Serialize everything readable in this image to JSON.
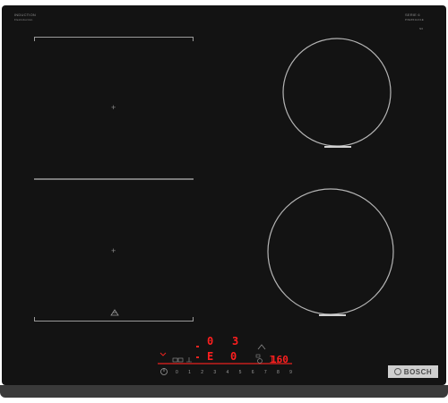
{
  "branding": {
    "top_left_label": "INDUCTION",
    "top_left_sublabel": "FlexInduction",
    "top_right_label": "SERIE 6",
    "top_right_sublabel": "PXE651HC1E",
    "top_right_code": "N6",
    "logo_text": "BOSCH"
  },
  "display": {
    "upper_value": "0",
    "upper_right_value": "3",
    "lower_value": "0",
    "lower_left_glyph": "E",
    "temperature": "160",
    "timer_glyph": "1:"
  },
  "power_scale": [
    "0",
    "1",
    "2",
    "3",
    "4",
    "5",
    "6",
    "7",
    "8",
    "9"
  ],
  "colors": {
    "glass": "#131313",
    "accent_red": "#e8231f",
    "outline": "#9a9a9a"
  },
  "icons": [
    "power-icon",
    "flex-zone-icon",
    "pan-icon",
    "sensor-icon",
    "timer-icon",
    "lock-icon"
  ]
}
